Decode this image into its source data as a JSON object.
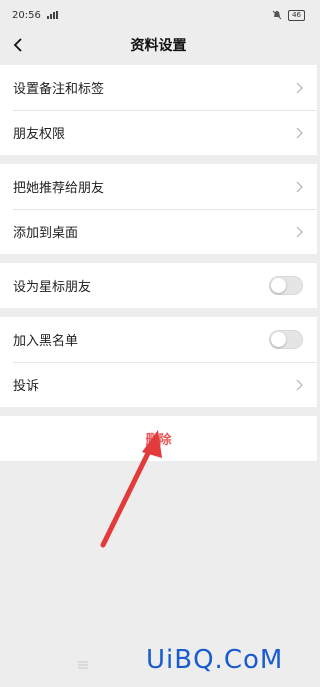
{
  "status_bar": {
    "time": "20:56",
    "network": "5G",
    "battery": "46"
  },
  "nav": {
    "title": "资料设置"
  },
  "groups": [
    {
      "items": [
        {
          "label": "设置备注和标签"
        },
        {
          "label": "朋友权限"
        }
      ]
    },
    {
      "items": [
        {
          "label": "把她推荐给朋友"
        },
        {
          "label": "添加到桌面"
        }
      ]
    },
    {
      "items": [
        {
          "label": "设为星标朋友",
          "toggle": false
        }
      ]
    },
    {
      "items": [
        {
          "label": "加入黑名单",
          "toggle": false
        },
        {
          "label": "投诉"
        }
      ]
    }
  ],
  "delete": {
    "label": "删除",
    "color": "#e85a5a"
  },
  "annotation": {
    "arrow_color": "#e33b3b"
  },
  "watermark": {
    "text": "UiBQ.CoM",
    "color": "#1a5ccf"
  }
}
